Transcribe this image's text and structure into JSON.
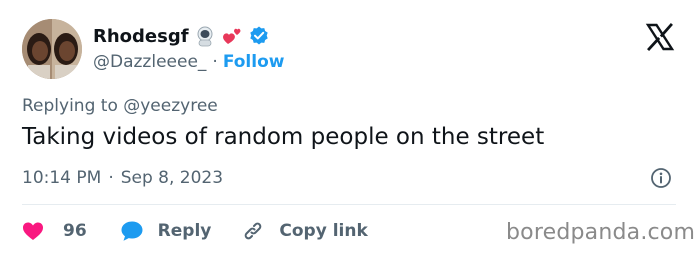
{
  "author": {
    "display_name": "Rhodesgf",
    "handle": "@Dazzleeee_",
    "separator": "·",
    "follow_label": "Follow",
    "verified": true
  },
  "tweet": {
    "replying_to": "Replying to @yeezyree",
    "text": "Taking videos of random people on the street",
    "time": "10:14 PM",
    "dot": "·",
    "date": "Sep 8, 2023"
  },
  "actions": {
    "like_count": "96",
    "reply_label": "Reply",
    "copy_link_label": "Copy link"
  },
  "watermark": "boredpanda.com",
  "icons": {
    "brand": "x-logo-icon",
    "verified": "verified-badge-icon",
    "info": "info-icon",
    "like": "heart-icon",
    "reply": "speech-bubble-icon",
    "copy": "link-icon"
  },
  "colors": {
    "accent": "#1d9bf0",
    "like": "#f91880",
    "text": "#0f1419",
    "muted": "#536471"
  }
}
